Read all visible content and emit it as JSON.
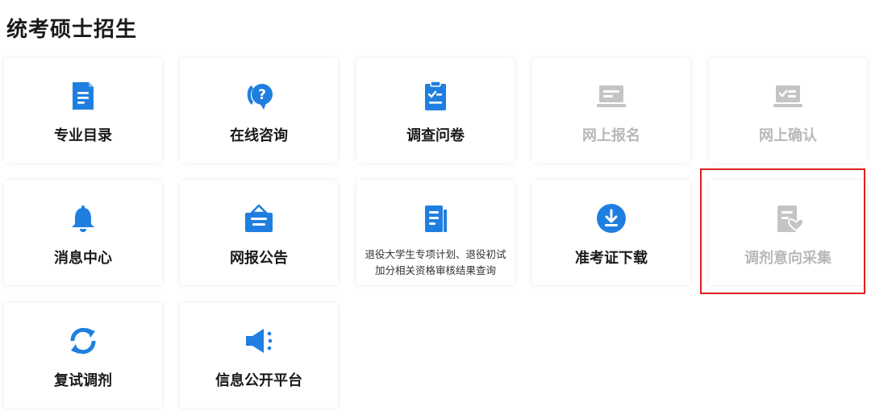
{
  "page": {
    "title": "统考硕士招生"
  },
  "colors": {
    "accent": "#1f7fe0",
    "disabled": "#c4c4c4",
    "highlight": "#e02020"
  },
  "tiles": [
    {
      "label": "专业目录",
      "icon": "document-icon",
      "state": "enabled"
    },
    {
      "label": "在线咨询",
      "icon": "question-chat-icon",
      "state": "enabled"
    },
    {
      "label": "调查问卷",
      "icon": "clipboard-check-icon",
      "state": "enabled"
    },
    {
      "label": "网上报名",
      "icon": "laptop-form-icon",
      "state": "disabled"
    },
    {
      "label": "网上确认",
      "icon": "laptop-check-icon",
      "state": "disabled"
    },
    {
      "label": "消息中心",
      "icon": "bell-icon",
      "state": "enabled"
    },
    {
      "label": "网报公告",
      "icon": "notice-board-icon",
      "state": "enabled"
    },
    {
      "line1": "退役大学生专项计划、退役初试",
      "line2": "加分相关资格审核结果查询",
      "icon": "doc-list-icon",
      "state": "enabled"
    },
    {
      "label": "准考证下载",
      "icon": "download-circle-icon",
      "state": "enabled"
    },
    {
      "label": "调剂意向采集",
      "icon": "doc-heart-icon",
      "state": "disabled"
    },
    {
      "label": "复试调剂",
      "icon": "refresh-icon",
      "state": "enabled"
    },
    {
      "label": "信息公开平台",
      "icon": "megaphone-icon",
      "state": "enabled"
    }
  ]
}
